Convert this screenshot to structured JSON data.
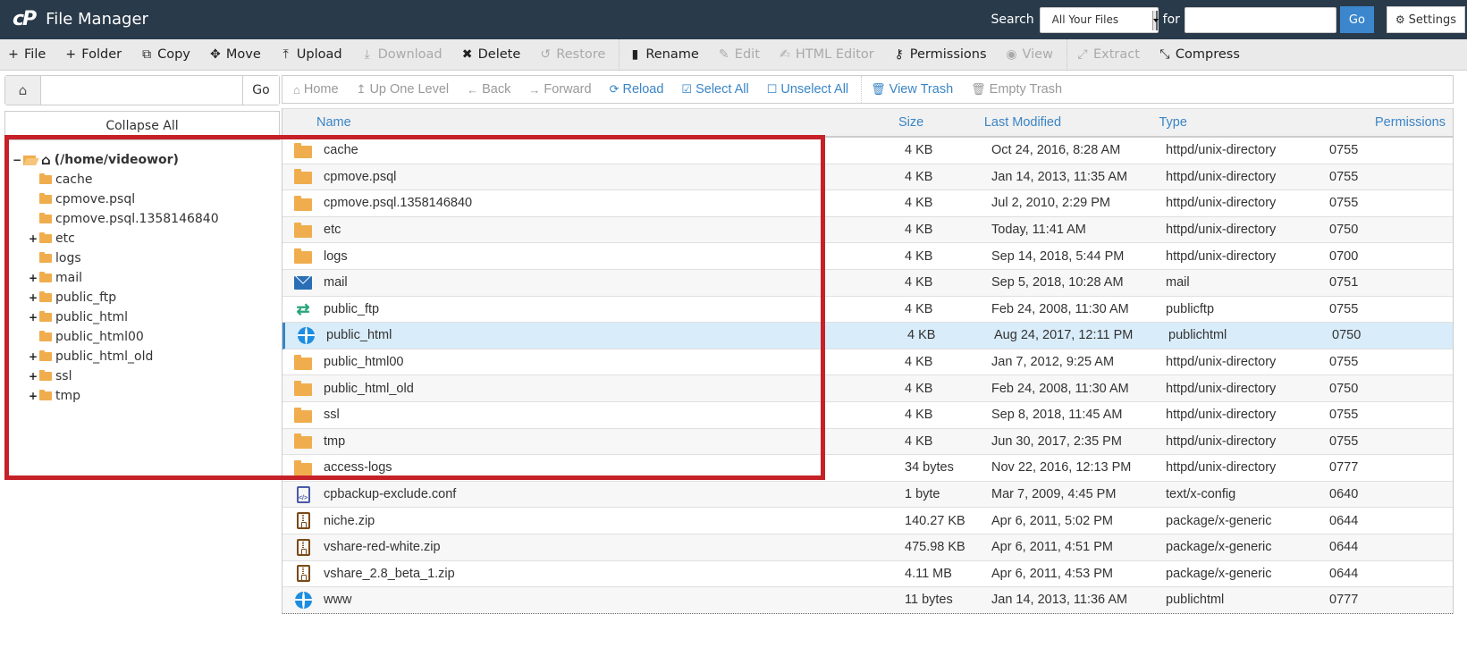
{
  "header": {
    "app_title": "File Manager",
    "logo_text": "cP",
    "search_label": "Search",
    "search_scope": "All Your Files",
    "for_label": "for",
    "search_query": "",
    "go_label": "Go",
    "settings_label": "Settings"
  },
  "toolbar": [
    {
      "id": "file",
      "label": "File",
      "icon": "+",
      "disabled": false
    },
    {
      "id": "folder",
      "label": "Folder",
      "icon": "+",
      "disabled": false
    },
    {
      "id": "copy",
      "label": "Copy",
      "icon": "⧉",
      "disabled": false
    },
    {
      "id": "move",
      "label": "Move",
      "icon": "✥",
      "disabled": false
    },
    {
      "id": "upload",
      "label": "Upload",
      "icon": "⤒",
      "disabled": false
    },
    {
      "id": "download",
      "label": "Download",
      "icon": "⤓",
      "disabled": true
    },
    {
      "id": "delete",
      "label": "Delete",
      "icon": "✖",
      "disabled": false
    },
    {
      "id": "restore",
      "label": "Restore",
      "icon": "↺",
      "disabled": true
    },
    {
      "id": "sep1",
      "separator": true
    },
    {
      "id": "rename",
      "label": "Rename",
      "icon": "▮",
      "disabled": false
    },
    {
      "id": "edit",
      "label": "Edit",
      "icon": "✎",
      "disabled": true
    },
    {
      "id": "html-editor",
      "label": "HTML Editor",
      "icon": "✍",
      "disabled": true
    },
    {
      "id": "permissions",
      "label": "Permissions",
      "icon": "⚷",
      "disabled": false
    },
    {
      "id": "view",
      "label": "View",
      "icon": "◉",
      "disabled": true
    },
    {
      "id": "sep2",
      "separator": true
    },
    {
      "id": "extract",
      "label": "Extract",
      "icon": "⤢",
      "disabled": true
    },
    {
      "id": "compress",
      "label": "Compress",
      "icon": "⤡",
      "disabled": false
    }
  ],
  "sidebar": {
    "path_value": "",
    "go_label": "Go",
    "collapse_all_label": "Collapse All",
    "tree_root": "(/home/videowor)",
    "tree": [
      {
        "name": "cache",
        "expandable": false
      },
      {
        "name": "cpmove.psql",
        "expandable": false
      },
      {
        "name": "cpmove.psql.1358146840",
        "expandable": false
      },
      {
        "name": "etc",
        "expandable": true
      },
      {
        "name": "logs",
        "expandable": false
      },
      {
        "name": "mail",
        "expandable": true
      },
      {
        "name": "public_ftp",
        "expandable": true
      },
      {
        "name": "public_html",
        "expandable": true
      },
      {
        "name": "public_html00",
        "expandable": false
      },
      {
        "name": "public_html_old",
        "expandable": true
      },
      {
        "name": "ssl",
        "expandable": true
      },
      {
        "name": "tmp",
        "expandable": true
      }
    ]
  },
  "content_toolbar": [
    {
      "id": "home",
      "label": "Home",
      "icon": "⌂",
      "active": false
    },
    {
      "id": "up-one-level",
      "label": "Up One Level",
      "icon": "↥",
      "active": false
    },
    {
      "id": "back",
      "label": "Back",
      "icon": "←",
      "active": false
    },
    {
      "id": "forward",
      "label": "Forward",
      "icon": "→",
      "active": false
    },
    {
      "id": "reload",
      "label": "Reload",
      "icon": "⟳",
      "active": true
    },
    {
      "id": "select-all",
      "label": "Select All",
      "icon": "☑",
      "active": true
    },
    {
      "id": "unselect-all",
      "label": "Unselect All",
      "icon": "☐",
      "active": true
    },
    {
      "id": "sep",
      "separator": true
    },
    {
      "id": "view-trash",
      "label": "View Trash",
      "icon": "🗑",
      "active": true
    },
    {
      "id": "empty-trash",
      "label": "Empty Trash",
      "icon": "🗑",
      "active": false
    }
  ],
  "table": {
    "columns": {
      "name": "Name",
      "size": "Size",
      "modified": "Last Modified",
      "type": "Type",
      "permissions": "Permissions"
    },
    "rows": [
      {
        "icon": "folder",
        "name": "cache",
        "size": "4 KB",
        "modified": "Oct 24, 2016, 8:28 AM",
        "type": "httpd/unix-directory",
        "perm": "0755"
      },
      {
        "icon": "folder",
        "name": "cpmove.psql",
        "size": "4 KB",
        "modified": "Jan 14, 2013, 11:35 AM",
        "type": "httpd/unix-directory",
        "perm": "0755"
      },
      {
        "icon": "folder",
        "name": "cpmove.psql.1358146840",
        "size": "4 KB",
        "modified": "Jul 2, 2010, 2:29 PM",
        "type": "httpd/unix-directory",
        "perm": "0755"
      },
      {
        "icon": "folder",
        "name": "etc",
        "size": "4 KB",
        "modified": "Today, 11:41 AM",
        "type": "httpd/unix-directory",
        "perm": "0750"
      },
      {
        "icon": "folder",
        "name": "logs",
        "size": "4 KB",
        "modified": "Sep 14, 2018, 5:44 PM",
        "type": "httpd/unix-directory",
        "perm": "0700"
      },
      {
        "icon": "mail",
        "name": "mail",
        "size": "4 KB",
        "modified": "Sep 5, 2018, 10:28 AM",
        "type": "mail",
        "perm": "0751"
      },
      {
        "icon": "ftp",
        "name": "public_ftp",
        "size": "4 KB",
        "modified": "Feb 24, 2008, 11:30 AM",
        "type": "publicftp",
        "perm": "0755"
      },
      {
        "icon": "globe",
        "name": "public_html",
        "size": "4 KB",
        "modified": "Aug 24, 2017, 12:11 PM",
        "type": "publichtml",
        "perm": "0750",
        "selected": true
      },
      {
        "icon": "folder",
        "name": "public_html00",
        "size": "4 KB",
        "modified": "Jan 7, 2012, 9:25 AM",
        "type": "httpd/unix-directory",
        "perm": "0755"
      },
      {
        "icon": "folder",
        "name": "public_html_old",
        "size": "4 KB",
        "modified": "Feb 24, 2008, 11:30 AM",
        "type": "httpd/unix-directory",
        "perm": "0750"
      },
      {
        "icon": "folder",
        "name": "ssl",
        "size": "4 KB",
        "modified": "Sep 8, 2018, 11:45 AM",
        "type": "httpd/unix-directory",
        "perm": "0755"
      },
      {
        "icon": "folder",
        "name": "tmp",
        "size": "4 KB",
        "modified": "Jun 30, 2017, 2:35 PM",
        "type": "httpd/unix-directory",
        "perm": "0755"
      },
      {
        "icon": "folder",
        "name": "access-logs",
        "size": "34 bytes",
        "modified": "Nov 22, 2016, 12:13 PM",
        "type": "httpd/unix-directory",
        "perm": "0777"
      },
      {
        "icon": "code",
        "name": "cpbackup-exclude.conf",
        "size": "1 byte",
        "modified": "Mar 7, 2009, 4:45 PM",
        "type": "text/x-config",
        "perm": "0640"
      },
      {
        "icon": "zip",
        "name": "niche.zip",
        "size": "140.27 KB",
        "modified": "Apr 6, 2011, 5:02 PM",
        "type": "package/x-generic",
        "perm": "0644"
      },
      {
        "icon": "zip",
        "name": "vshare-red-white.zip",
        "size": "475.98 KB",
        "modified": "Apr 6, 2011, 4:51 PM",
        "type": "package/x-generic",
        "perm": "0644"
      },
      {
        "icon": "zip",
        "name": "vshare_2.8_beta_1.zip",
        "size": "4.11 MB",
        "modified": "Apr 6, 2011, 4:53 PM",
        "type": "package/x-generic",
        "perm": "0644"
      },
      {
        "icon": "globe",
        "name": "www",
        "size": "11 bytes",
        "modified": "Jan 14, 2013, 11:36 AM",
        "type": "publichtml",
        "perm": "0777"
      }
    ]
  },
  "colors": {
    "header_bg": "#293a4a",
    "accent_blue": "#3a85c6",
    "folder": "#f0ad4e",
    "selected_row": "#d9ecf9",
    "highlight_box": "#c62128"
  }
}
